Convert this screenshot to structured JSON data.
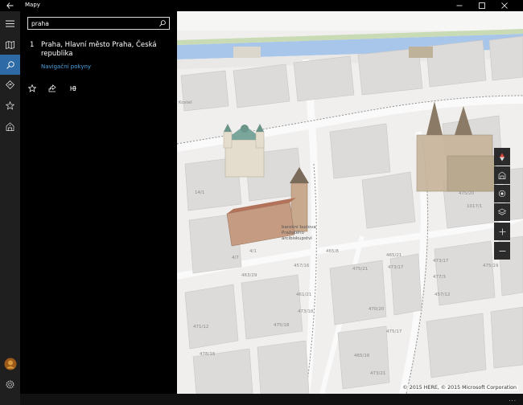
{
  "window": {
    "title": "Mapy"
  },
  "rail": {
    "items": [
      {
        "name": "hamburger-icon"
      },
      {
        "name": "map-icon"
      },
      {
        "name": "search-icon"
      },
      {
        "name": "directions-icon"
      },
      {
        "name": "favorites-icon"
      },
      {
        "name": "city-3d-icon"
      }
    ],
    "bottom": [
      {
        "name": "avatar"
      },
      {
        "name": "settings-icon"
      }
    ]
  },
  "search": {
    "value": "praha",
    "placeholder": ""
  },
  "result": {
    "index": "1",
    "title": "Praha, Hlavní město Praha, Česká republika",
    "link": "Navigační pokyny"
  },
  "result_actions": [
    "favorite-icon",
    "share-icon",
    "pin-icon"
  ],
  "map": {
    "copyright": "© 2015 HERE, © 2015 Microsoft Corporation",
    "labels": [
      {
        "text": "Kostel",
        "cls": "a"
      },
      {
        "text": "14/1",
        "cls": "b"
      },
      {
        "text": "475/20",
        "cls": "c"
      },
      {
        "text": "1017/1",
        "cls": "d"
      },
      {
        "text": "465/8",
        "cls": "e"
      },
      {
        "text": "4/7",
        "cls": "f"
      },
      {
        "text": "457/16",
        "cls": "g"
      },
      {
        "text": "465/21",
        "cls": "h"
      },
      {
        "text": "473/17",
        "cls": "i"
      },
      {
        "text": "463/29",
        "cls": "j"
      },
      {
        "text": "475/21",
        "cls": "k"
      },
      {
        "text": "473/17",
        "cls": "l"
      },
      {
        "text": "477/3",
        "cls": "m"
      },
      {
        "text": "475/19",
        "cls": "n"
      },
      {
        "text": "461/21",
        "cls": "o"
      },
      {
        "text": "457/12",
        "cls": "p"
      },
      {
        "text": "470/20",
        "cls": "q"
      },
      {
        "text": "473/18",
        "cls": "r"
      },
      {
        "text": "475/18",
        "cls": "s"
      },
      {
        "text": "475/17",
        "cls": "t"
      },
      {
        "text": "465/16",
        "cls": "u"
      },
      {
        "text": "478/16",
        "cls": "v"
      },
      {
        "text": "473/21",
        "cls": "w"
      },
      {
        "text": "471/12",
        "cls": "x"
      },
      {
        "text": "4/1",
        "cls": "y"
      }
    ],
    "poi_label": "barokní budova Pražského arcibiskupství"
  },
  "map_controls": [
    "compass-icon",
    "buildings-icon",
    "location-icon",
    "layers-icon",
    "zoom-in-icon",
    "zoom-out-icon"
  ],
  "more": "..."
}
